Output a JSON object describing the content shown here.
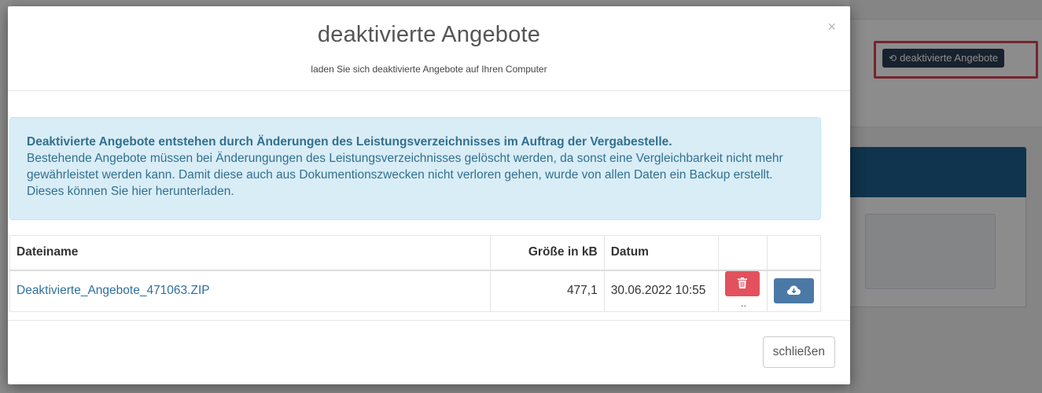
{
  "background": {
    "button_label": "deaktivierte Angebote",
    "button_icon": "history-icon"
  },
  "modal": {
    "title": "deaktivierte Angebote",
    "subtitle": "laden Sie sich deaktivierte Angebote auf Ihren Computer",
    "close_icon": "×",
    "info_heading": "Deaktivierte Angebote entstehen durch Änderungen des Leistungsverzeichnisses im Auftrag der Vergabestelle.",
    "info_text": "Bestehende Angebote müssen bei Änderungungen des Leistungsverzeichnisses gelöscht werden, da sonst eine Vergleichbarkeit nicht mehr gewährleistet werden kann. Damit diese auch aus Dokumentionszwecken nicht verloren gehen, wurde von allen Daten ein Backup erstellt. Dieses können Sie hier herunterladen.",
    "table": {
      "headers": [
        "Dateiname",
        "Größe in kB",
        "Datum",
        "",
        ""
      ],
      "rows": [
        {
          "filename": "Deaktivierte_Angebote_471063.ZIP",
          "size": "477,1",
          "date": "30.06.2022 10:55",
          "delete_icon": "trash-icon",
          "download_icon": "cloud-download-icon",
          "ellipsis": ".."
        }
      ]
    },
    "close_button": "schließen"
  },
  "colors": {
    "info_bg": "#d9edf7",
    "info_text": "#31708f",
    "link": "#2f6f9f",
    "danger": "#e2515d",
    "primary": "#4b79a6",
    "highlight": "#d64452"
  }
}
